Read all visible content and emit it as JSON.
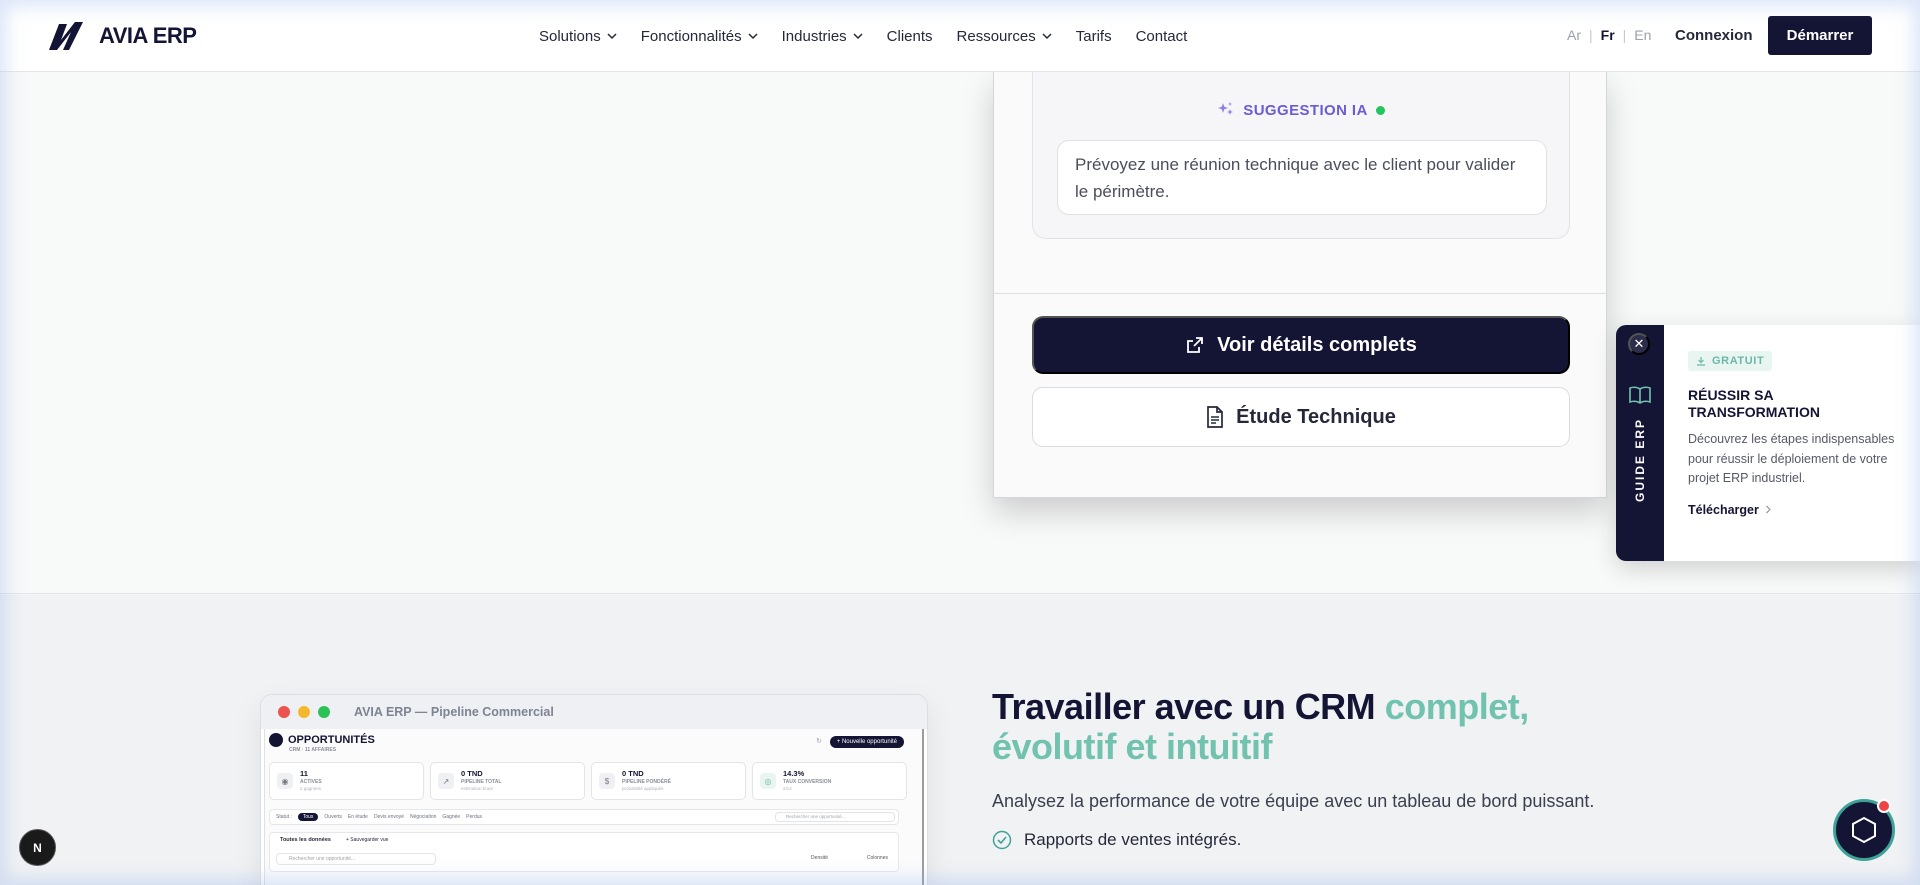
{
  "brand": {
    "name": "AVIA ERP"
  },
  "nav": {
    "items": [
      {
        "label": "Solutions",
        "dropdown": true
      },
      {
        "label": "Fonctionnalités",
        "dropdown": true
      },
      {
        "label": "Industries",
        "dropdown": true
      },
      {
        "label": "Clients",
        "dropdown": false
      },
      {
        "label": "Ressources",
        "dropdown": true
      },
      {
        "label": "Tarifs",
        "dropdown": false
      },
      {
        "label": "Contact",
        "dropdown": false
      }
    ],
    "languages": {
      "ar": "Ar",
      "fr": "Fr",
      "en": "En",
      "active": "Fr"
    },
    "login": "Connexion",
    "cta": "Démarrer"
  },
  "card": {
    "suggestion_label": "SUGGESTION IA",
    "suggestion_text": "Prévoyez une réunion technique avec le client pour valider le périmètre.",
    "primary_button": "Voir détails complets",
    "secondary_button": "Étude Technique"
  },
  "guide": {
    "vertical_label": "GUIDE ERP",
    "badge": "GRATUIT",
    "title": "RÉUSSIR SA TRANSFORMATION",
    "description": "Découvrez les étapes indispensables pour réussir le déploiement de votre projet ERP industriel.",
    "download": "Télécharger"
  },
  "app_window": {
    "title": "AVIA ERP — Pipeline Commercial",
    "header": "OPPORTUNITÉS",
    "subheader": "CRM · 11 AFFAIRES",
    "new_button": "+ Nouvelle opportunité",
    "kpis": [
      {
        "value": "11",
        "label": "ACTIVES",
        "sub": "2 gagnées",
        "icon": "target-icon"
      },
      {
        "value": "0 TND",
        "label": "PIPELINE TOTAL",
        "sub": "estimation brute",
        "icon": "trend-icon"
      },
      {
        "value": "0 TND",
        "label": "PIPELINE PONDÉRÉ",
        "sub": "probabilité appliquée",
        "icon": "dollar-icon"
      },
      {
        "value": "14.3%",
        "label": "TAUX CONVERSION",
        "sub": "2/14",
        "icon": "check-circle-icon"
      }
    ],
    "status_label": "Statut :",
    "status_filters": [
      "Tous",
      "Ouverts",
      "En étude",
      "Devis envoyé",
      "Négociation",
      "Gagnée",
      "Perdus"
    ],
    "active_filter": "Tous",
    "status_search_placeholder": "Rechercher une opportunité...",
    "tab_all": "Toutes les données",
    "tab_save": "+ Sauvegarder vue",
    "search_placeholder": "Rechercher une opportunité...",
    "density": "Densité",
    "columns": "Colonnes"
  },
  "feature": {
    "title_dark": "Travailler avec un CRM ",
    "title_accent": "complet, évolutif et intuitif",
    "description": "Analysez la performance de votre équipe avec un tableau de bord puissant.",
    "item_1": "Rapports de ventes intégrés."
  },
  "n_badge": "N",
  "colors": {
    "navy": "#141434",
    "teal": "#72c2b0",
    "purple": "#6a5cd6",
    "green": "#22c55e"
  }
}
